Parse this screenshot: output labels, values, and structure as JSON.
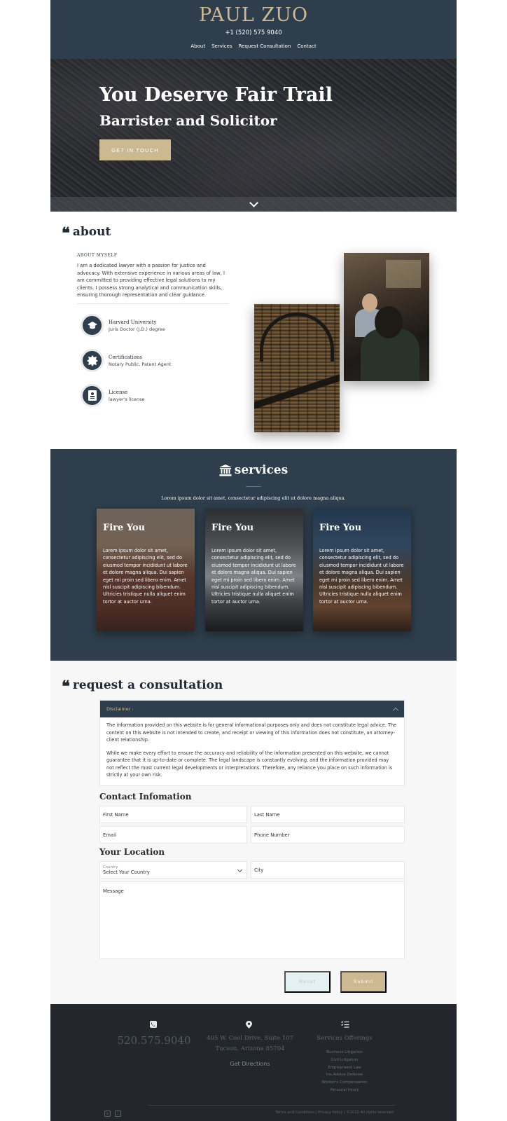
{
  "header": {
    "brand": "PAUL ZUO",
    "phone": "+1 (520) 575 9040",
    "nav": [
      "About",
      "Services",
      "Request Consultation",
      "Contact"
    ]
  },
  "hero": {
    "title": "You Deserve Fair Trail",
    "subtitle": "Barrister and Solicitor",
    "cta": "GET IN TOUCH"
  },
  "about": {
    "heading": "about",
    "eyebrow": "ABOUT MYSELF",
    "text": "I am a dedicated lawyer with a passion for justice and advocacy. With extensive experience in various areas of law, I am committed to providing effective legal solutions to my clients. I possess strong analytical and communication skills, ensuring thorough representation and clear guidance.",
    "credentials": [
      {
        "title": "Harvard University",
        "sub": "Juris Doctor (J.D.) degree",
        "icon": "graduation-cap-icon"
      },
      {
        "title": "Certifications",
        "sub": "Notary Public, Patent Agent",
        "icon": "badge-icon"
      },
      {
        "title": "License",
        "sub": "lawyer's license",
        "icon": "id-card-icon"
      }
    ]
  },
  "services": {
    "heading": "services",
    "description": "Lorem ipsum dolor sit amet, consectetur adipiscing elit ut dolore magna aliqua.",
    "cards": [
      {
        "title": "Fire You",
        "text": "Lorem ipsum dolor sit amet, consectetur adipiscing elit, sed do eiusmod tempor incididunt ut labore et dolore magna aliqua. Dui sapien eget mi proin sed libero enim. Amet nisl suscipit adipiscing bibendum. Ultricies tristique nulla aliquet enim tortor at auctor urna."
      },
      {
        "title": "Fire You",
        "text": "Lorem ipsum dolor sit amet, consectetur adipiscing elit, sed do eiusmod tempor incididunt ut labore et dolore magna aliqua. Dui sapien eget mi proin sed libero enim. Amet nisl suscipit adipiscing bibendum. Ultricies tristique nulla aliquet enim tortor at auctor urna."
      },
      {
        "title": "Fire You",
        "text": "Lorem ipsum dolor sit amet, consectetur adipiscing elit, sed do eiusmod tempor incididunt ut labore et dolore magna aliqua. Dui sapien eget mi proin sed libero enim. Amet nisl suscipit adipiscing bibendum. Ultricies tristique nulla aliquet enim tortor at auctor urna."
      }
    ]
  },
  "consult": {
    "heading": "request a consultation",
    "disclaimer_label": "Disclaimer :",
    "disclaimer_p1": "The information provided on this website is for general informational purposes only and does not constitute legal advice. The content on this website is not intended to create, and receipt or viewing of this information does not constitute, an attorney-client relationship.",
    "disclaimer_p2": "While we make every effort to ensure the accuracy and reliability of the information presented on this website, we cannot guarantee that it is up-to-date or complete. The legal landscape is constantly evolving, and the information provided may not reflect the most current legal developments or interpretations. Therefore, any reliance you place on such information is strictly at your own risk.",
    "contact_heading": "Contact Infomation",
    "first_name": "First Name",
    "last_name": "Last Name",
    "email": "Email",
    "phone_number": "Phone Number",
    "location_heading": "Your Location",
    "country_label": "Country",
    "country_value": "Select Your Country",
    "city": "City",
    "message": "Message",
    "reset": "Reset",
    "submit": "Submit"
  },
  "footer": {
    "phone": "520.575.9040",
    "address_line1": "405 W. Cool Drive, Suite 107",
    "address_line2": "Tucson, Arizona 85704",
    "directions": "Get Directions",
    "services_title": "Services Offerings",
    "services_list": [
      "Business Litigation",
      "Civil Litigation",
      "Employment Law",
      "Ins.Advice Defense",
      "Worker's Compensation",
      "Personal Injury"
    ],
    "legal": "Terms and Conditions | Privacy Policy | ©2023 All rights reserved"
  },
  "colors": {
    "navy": "#2f3e4c",
    "gold": "#cdb991",
    "footer": "#23272b"
  }
}
